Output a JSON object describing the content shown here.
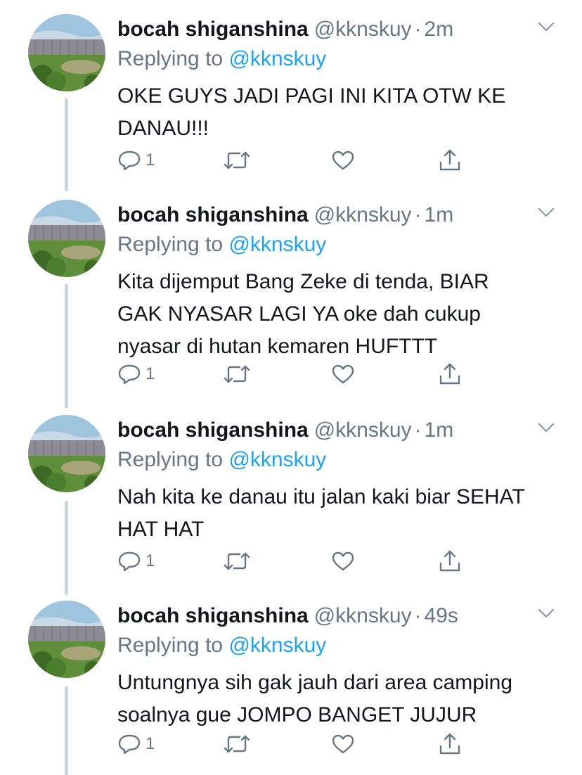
{
  "tweets": [
    {
      "name": "bocah shiganshina",
      "handle": "@kknskuy",
      "dot": "·",
      "time": "2m",
      "reply_prefix": "Replying to",
      "reply_mention": "@kknskuy",
      "lines": [
        "OKE GUYS JADI PAGI INI KITA OTW KE",
        "DANAU!!!"
      ],
      "reply_count": "1"
    },
    {
      "name": "bocah shiganshina",
      "handle": "@kknskuy",
      "dot": "·",
      "time": "1m",
      "reply_prefix": "Replying to",
      "reply_mention": "@kknskuy",
      "lines": [
        "Kita dijemput Bang Zeke di tenda, BIAR",
        "GAK NYASAR LAGI YA oke dah cukup",
        "nyasar di hutan kemaren HUFTTT"
      ],
      "reply_count": "1"
    },
    {
      "name": "bocah shiganshina",
      "handle": "@kknskuy",
      "dot": "·",
      "time": "1m",
      "reply_prefix": "Replying to",
      "reply_mention": "@kknskuy",
      "lines": [
        "Nah kita ke danau itu jalan kaki biar SEHAT",
        "HAT HAT"
      ],
      "reply_count": "1"
    },
    {
      "name": "bocah shiganshina",
      "handle": "@kknskuy",
      "dot": "·",
      "time": "49s",
      "reply_prefix": "Replying to",
      "reply_mention": "@kknskuy",
      "lines": [
        "Untungnya sih gak jauh dari area camping",
        "soalnya gue JOMPO BANGET JUJUR"
      ],
      "reply_count": "1"
    }
  ],
  "colors": {
    "text": "#14171a",
    "secondary": "#657786",
    "link": "#1da1f2",
    "thread_line": "#ccd6dd"
  },
  "icons": {
    "avatar": "avatar-landscape-image",
    "caret": "chevron-down-icon",
    "reply": "reply-icon",
    "retweet": "retweet-icon",
    "like": "heart-icon",
    "share": "share-icon"
  }
}
